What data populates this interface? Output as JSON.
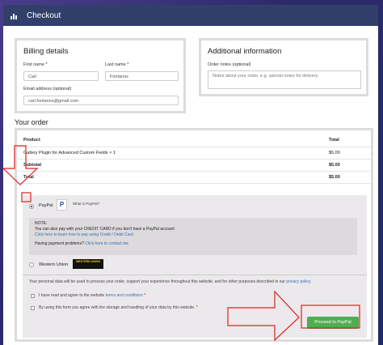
{
  "app": {
    "title": "Checkout",
    "icon": "bar-chart-icon"
  },
  "billing": {
    "title": "Billing details",
    "first_name_label": "First name *",
    "first_name_value": "Carl",
    "last_name_label": "Last name *",
    "last_name_value": "Fontanos",
    "email_label": "Email address (optional)",
    "email_value": "carl.fontanos@gmail.com"
  },
  "additional": {
    "title": "Additional information",
    "notes_label": "Order notes (optional)",
    "notes_placeholder": "Notes about your order, e.g. special notes for delivery."
  },
  "order": {
    "title": "Your order",
    "headers": [
      "Product",
      "Total"
    ],
    "rows": [
      {
        "product": "Gallery Plugin for Advanced Custom Fields × 1",
        "total": "$5.00"
      },
      {
        "product": "Subtotal",
        "total": "$5.00"
      },
      {
        "product": "Total",
        "total": "$5.00"
      }
    ]
  },
  "payment": {
    "paypal_label": "PayPal",
    "paypal_what": "What is PayPal?",
    "note_title": "NOTE:",
    "note_line1": "You can also pay with your CREDIT CARD if you don't have a PayPal account",
    "note_link": "Click here to learn how to pay using Credit / Debit Card",
    "problems_text": "Having payment problems?",
    "problems_link": "Click here to contact me",
    "western_union_label": "Western Union",
    "western_union_logo": "WESTERN UNION",
    "privacy_text": "Your personal data will be used to process your order, support your experience throughout this website, and for other purposes described in our",
    "privacy_link": "privacy policy.",
    "terms_text": "I have read and agree to the website",
    "terms_link": "terms and conditions",
    "terms_star": "*",
    "consent_text": "By using this form you agree with the storage and handling of your data by this website.",
    "consent_star": "*",
    "proceed_label": "Proceed to PayPal"
  },
  "colors": {
    "topbar": "#31406a",
    "button": "#4caf50",
    "link": "#3a6fb8",
    "annotation": "#e02020"
  }
}
